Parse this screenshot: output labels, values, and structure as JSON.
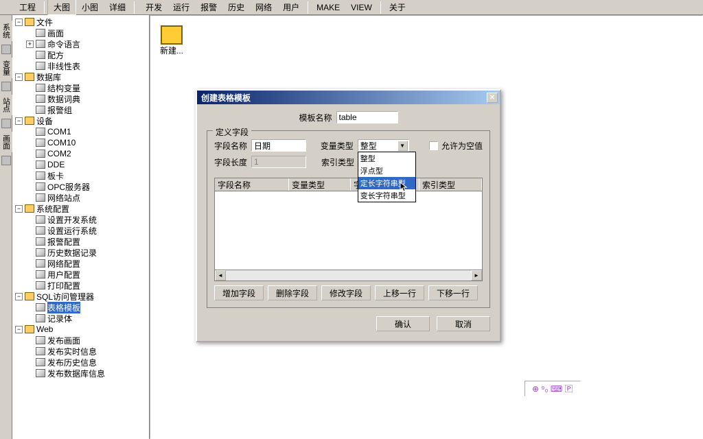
{
  "menubar": {
    "left": [
      {
        "label": "工程"
      },
      {
        "label": "大图",
        "active": true
      },
      {
        "label": "小图"
      },
      {
        "label": "详细"
      }
    ],
    "right": [
      {
        "label": "开发"
      },
      {
        "label": "运行"
      },
      {
        "label": "报警"
      },
      {
        "label": "历史"
      },
      {
        "label": "网络"
      },
      {
        "label": "用户"
      },
      {
        "label": "MAKE"
      },
      {
        "label": "VIEW"
      },
      {
        "label": "关于"
      }
    ]
  },
  "left_tabs": [
    "系统",
    "变量",
    "站点",
    "画面"
  ],
  "tree": {
    "root": [
      {
        "label": "文件",
        "expanded": true,
        "icon": "folder-open",
        "children": [
          {
            "label": "画面",
            "icon": "generic"
          },
          {
            "label": "命令语言",
            "icon": "generic",
            "expander": "+"
          },
          {
            "label": "配方",
            "icon": "generic"
          },
          {
            "label": "非线性表",
            "icon": "generic"
          }
        ]
      },
      {
        "label": "数据库",
        "expanded": true,
        "icon": "folder-open",
        "children": [
          {
            "label": "结构变量",
            "icon": "generic"
          },
          {
            "label": "数据词典",
            "icon": "generic"
          },
          {
            "label": "报警组",
            "icon": "generic"
          }
        ]
      },
      {
        "label": "设备",
        "expanded": true,
        "icon": "folder-open",
        "children": [
          {
            "label": "COM1",
            "icon": "generic"
          },
          {
            "label": "COM10",
            "icon": "generic"
          },
          {
            "label": "COM2",
            "icon": "generic"
          },
          {
            "label": "DDE",
            "icon": "generic"
          },
          {
            "label": "板卡",
            "icon": "generic"
          },
          {
            "label": "OPC服务器",
            "icon": "generic"
          },
          {
            "label": "网络站点",
            "icon": "generic"
          }
        ]
      },
      {
        "label": "系统配置",
        "expanded": true,
        "icon": "folder-open",
        "children": [
          {
            "label": "设置开发系统",
            "icon": "generic"
          },
          {
            "label": "设置运行系统",
            "icon": "generic"
          },
          {
            "label": "报警配置",
            "icon": "generic"
          },
          {
            "label": "历史数据记录",
            "icon": "generic"
          },
          {
            "label": "网络配置",
            "icon": "generic"
          },
          {
            "label": "用户配置",
            "icon": "generic"
          },
          {
            "label": "打印配置",
            "icon": "generic"
          }
        ]
      },
      {
        "label": "SQL访问管理器",
        "expanded": true,
        "icon": "folder-open",
        "children": [
          {
            "label": "表格模板",
            "icon": "generic",
            "selected": true
          },
          {
            "label": "记录体",
            "icon": "generic"
          }
        ]
      },
      {
        "label": "Web",
        "expanded": true,
        "icon": "folder-open",
        "children": [
          {
            "label": "发布画面",
            "icon": "generic"
          },
          {
            "label": "发布实时信息",
            "icon": "generic"
          },
          {
            "label": "发布历史信息",
            "icon": "generic"
          },
          {
            "label": "发布数据库信息",
            "icon": "generic"
          }
        ]
      }
    ]
  },
  "content": {
    "launch_label": "新建..."
  },
  "dialog": {
    "title": "创建表格模板",
    "template_name_label": "模板名称",
    "template_name_value": "table",
    "fieldset_legend": "定义字段",
    "field_name_label": "字段名称",
    "field_name_value": "日期",
    "var_type_label": "变量类型",
    "var_type_value": "整型",
    "var_type_options": [
      "整型",
      "浮点型",
      "定长字符串型",
      "变长字符串型"
    ],
    "field_len_label": "字段长度",
    "field_len_value": "1",
    "index_type_label": "索引类型",
    "allow_null_label": "允许为空值",
    "grid_cols": [
      "字段名称",
      "变量类型",
      "字段长度",
      "索引类型"
    ],
    "btn_add": "增加字段",
    "btn_del": "删除字段",
    "btn_mod": "修改字段",
    "btn_up": "上移一行",
    "btn_down": "下移一行",
    "btn_ok": "确认",
    "btn_cancel": "取消",
    "highlighted_option_index": 2
  },
  "status_icons": "⊕ ⁹₀ ⌨ 🄿"
}
